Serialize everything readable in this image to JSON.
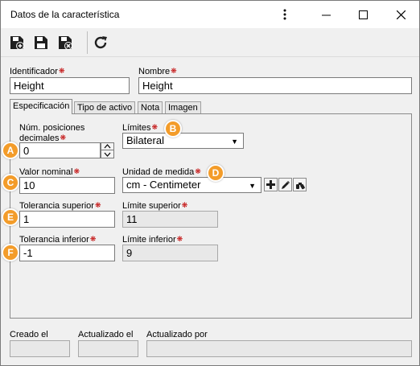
{
  "window": {
    "title": "Datos de la característica"
  },
  "toolbar": {
    "save_new": "save-new-icon",
    "save": "save-icon",
    "save_close": "save-close-icon",
    "refresh": "refresh-icon"
  },
  "header": {
    "identifier_label": "Identificador",
    "identifier_value": "Height",
    "name_label": "Nombre",
    "name_value": "Height"
  },
  "tabs": [
    {
      "label": "Especificación",
      "active": true
    },
    {
      "label": "Tipo de activo",
      "active": false
    },
    {
      "label": "Nota",
      "active": false
    },
    {
      "label": "Imagen",
      "active": false
    }
  ],
  "spec": {
    "decimals_label_line1": "Núm. posiciones",
    "decimals_label_line2": "decimales",
    "decimals_value": "0",
    "limits_label": "Límites",
    "limits_value": "Bilateral",
    "nominal_label": "Valor nominal",
    "nominal_value": "10",
    "unit_label": "Unidad de medida",
    "unit_value": "cm - Centimeter",
    "upper_tol_label": "Tolerancia superior",
    "upper_tol_value": "1",
    "upper_limit_label": "Límite superior",
    "upper_limit_value": "11",
    "lower_tol_label": "Tolerancia inferior",
    "lower_tol_value": "-1",
    "lower_limit_label": "Límite inferior",
    "lower_limit_value": "9"
  },
  "badges": {
    "a": "A",
    "b": "B",
    "c": "C",
    "d": "D",
    "e": "E",
    "f": "F"
  },
  "footer": {
    "created_label": "Creado el",
    "created_value": "",
    "updated_label": "Actualizado el",
    "updated_value": "",
    "updated_by_label": "Actualizado por",
    "updated_by_value": ""
  },
  "colors": {
    "badge": "#f39c2a",
    "required": "#c00000"
  }
}
